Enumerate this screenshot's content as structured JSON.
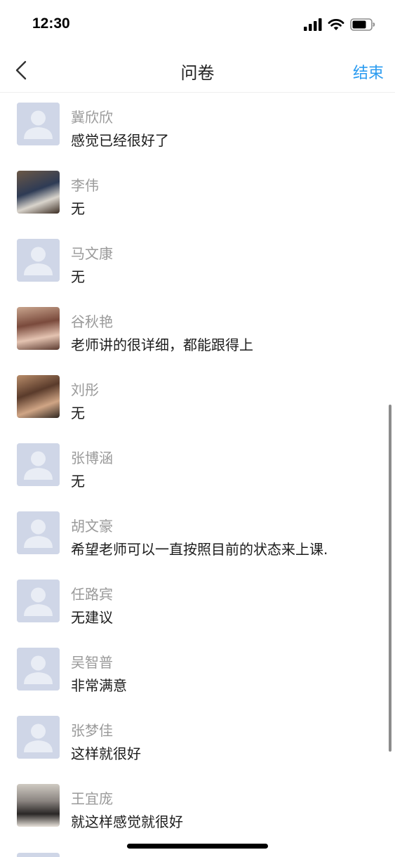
{
  "status_bar": {
    "time": "12:30",
    "icons": [
      "cellular-signal-icon",
      "wifi-icon",
      "battery-icon"
    ]
  },
  "nav": {
    "back_icon": "chevron-left-icon",
    "title": "问卷",
    "action_label": "结束"
  },
  "colors": {
    "accent": "#2a9bf0",
    "name_text": "#9a9a9a",
    "answer_text": "#1c1c1c",
    "placeholder_avatar": "#cfd6e7"
  },
  "responses": [
    {
      "name": "冀欣欣",
      "answer": "感觉已经很好了",
      "avatar": "default"
    },
    {
      "name": "李伟",
      "answer": "无",
      "avatar": "photo"
    },
    {
      "name": "马文康",
      "answer": "无",
      "avatar": "default"
    },
    {
      "name": "谷秋艳",
      "answer": "老师讲的很详细，都能跟得上",
      "avatar": "photo"
    },
    {
      "name": "刘彤",
      "answer": "无",
      "avatar": "photo"
    },
    {
      "name": "张博涵",
      "answer": "无",
      "avatar": "default"
    },
    {
      "name": "胡文豪",
      "answer": "希望老师可以一直按照目前的状态来上课.",
      "avatar": "default"
    },
    {
      "name": "任路宾",
      "answer": "无建议",
      "avatar": "default"
    },
    {
      "name": "吴智普",
      "answer": "非常满意",
      "avatar": "default"
    },
    {
      "name": "张梦佳",
      "answer": "这样就很好",
      "avatar": "default"
    },
    {
      "name": "王宜庞",
      "answer": "就这样感觉就很好",
      "avatar": "photo"
    }
  ]
}
